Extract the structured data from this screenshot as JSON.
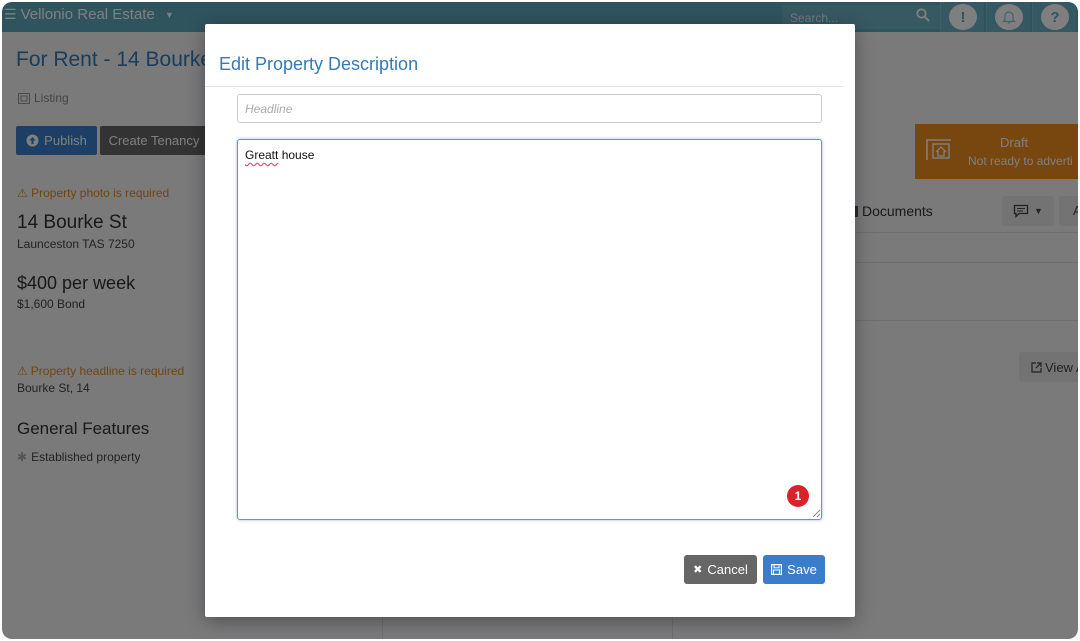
{
  "topbar": {
    "brand": "Vellonio Real Estate",
    "search_placeholder": "Search...",
    "alert_glyph": "!",
    "help_glyph": "?"
  },
  "page": {
    "title": "For Rent - 14 Bourke",
    "listing_label": "Listing",
    "publish_label": "Publish",
    "create_tenancy_label": "Create Tenancy",
    "photo_warning": "Property photo is required",
    "address_line1": "14 Bourke St",
    "address_line2": "Launceston TAS 7250",
    "price": "$400 per week",
    "bond": "$1,600 Bond",
    "headline_warning": "Property headline is required",
    "street": "Bourke St, 14",
    "features_heading": "General Features",
    "feature_item": "Established property",
    "draft_title": "Draft",
    "draft_subtitle": "Not ready to adverti",
    "documents_tab": "Documents",
    "a_button": "A",
    "view_button": "View A"
  },
  "modal": {
    "title": "Edit Property Description",
    "headline_placeholder": "Headline",
    "headline_value": "",
    "description_word1": "Greatt",
    "description_rest": " house",
    "error_count": "1",
    "cancel_label": "Cancel",
    "save_label": "Save"
  },
  "colors": {
    "topbar": "#5fa9bd",
    "primary": "#3a7ecb",
    "secondary": "#666666",
    "warning": "#f08c1e",
    "error": "#d8232a"
  },
  "icons": [
    "menu-icon",
    "caret-down-icon",
    "search-icon",
    "alert-icon",
    "bell-icon",
    "help-icon",
    "listing-icon",
    "upload-icon",
    "warning-icon",
    "asterisk-icon",
    "house-icon",
    "documents-icon",
    "comment-icon",
    "external-link-icon",
    "close-icon",
    "floppy-icon"
  ]
}
